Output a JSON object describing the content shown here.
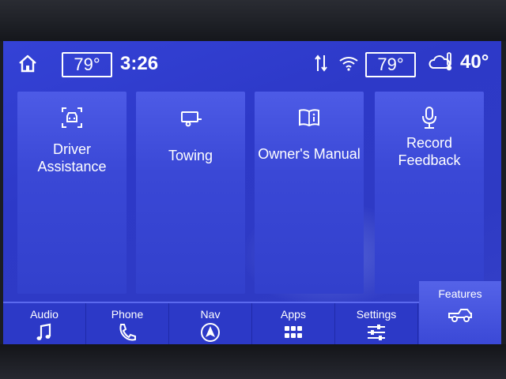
{
  "status": {
    "cabin_temp_left": "79°",
    "clock": "3:26",
    "cabin_temp_right": "79°",
    "outside_temp": "40°",
    "icons": [
      "home-icon",
      "signal-arrows-icon",
      "wifi-icon",
      "weather-thermometer-icon"
    ]
  },
  "tiles": [
    {
      "label": "Driver\nAssistance",
      "icon": "driver-assist-icon"
    },
    {
      "label": "Towing",
      "icon": "trailer-icon"
    },
    {
      "label": "Owner's Manual",
      "icon": "book-info-icon"
    },
    {
      "label": "Record\nFeedback",
      "icon": "microphone-icon"
    }
  ],
  "nav": [
    {
      "label": "Audio",
      "icon": "music-note-icon"
    },
    {
      "label": "Phone",
      "icon": "phone-icon"
    },
    {
      "label": "Nav",
      "icon": "navigation-arrow-icon"
    },
    {
      "label": "Apps",
      "icon": "apps-grid-icon"
    },
    {
      "label": "Settings",
      "icon": "sliders-icon"
    },
    {
      "label": "Features",
      "icon": "truck-icon",
      "active": true
    }
  ],
  "colors": {
    "screen": "#2e3ac4",
    "tile": "#3a48d6",
    "active": "#5563e8",
    "text": "#ffffff"
  }
}
